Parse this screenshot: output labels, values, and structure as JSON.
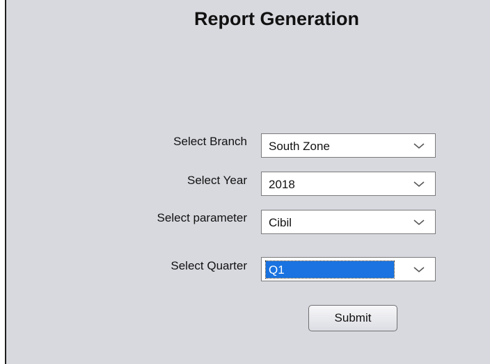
{
  "title": "Report Generation",
  "fields": {
    "branch": {
      "label": "Select Branch",
      "value": "South Zone"
    },
    "year": {
      "label": "Select Year",
      "value": "2018"
    },
    "parameter": {
      "label": "Select parameter",
      "value": "Cibil"
    },
    "quarter": {
      "label": "Select Quarter",
      "value": "Q1"
    }
  },
  "submit_label": "Submit",
  "colors": {
    "panel_background": "#d8d9df",
    "selection_highlight": "#1a73e0"
  },
  "icons": {
    "dropdown": "chevron-down-icon"
  }
}
